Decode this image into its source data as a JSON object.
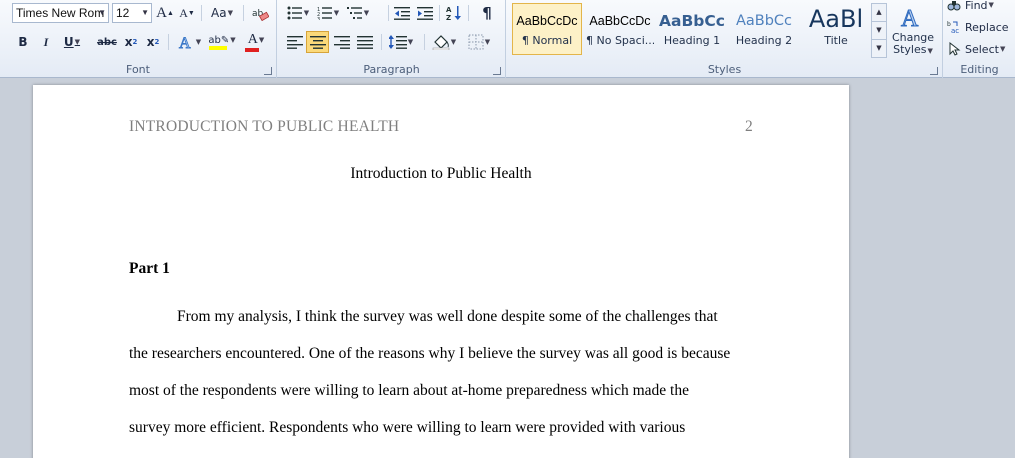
{
  "font_group": {
    "label": "Font",
    "font_name": "Times New Rom",
    "font_size": "12",
    "grow_label": "A",
    "shrink_label": "A",
    "case_label": "Aa",
    "bold": "B",
    "italic": "I",
    "underline": "U",
    "strikethrough": "abc",
    "subscript": "x",
    "subscript_mark": "2",
    "superscript": "x",
    "superscript_mark": "2",
    "highlight_label": "ab",
    "font_color_label": "A"
  },
  "paragraph_group": {
    "label": "Paragraph",
    "pilcrow": "¶"
  },
  "styles_group": {
    "label": "Styles",
    "tiles": [
      {
        "preview": "AaBbCcDc",
        "name": "¶ Normal"
      },
      {
        "preview": "AaBbCcDc",
        "name": "¶ No Spaci..."
      },
      {
        "preview": "AaBbCc",
        "name": "Heading 1"
      },
      {
        "preview": "AaBbCc",
        "name": "Heading 2"
      },
      {
        "preview": "AaBl",
        "name": "Title"
      }
    ],
    "change_styles": "Change Styles",
    "change_line1": "Change",
    "change_line2": "Styles"
  },
  "editing_group": {
    "label": "Editing",
    "find": "Find",
    "replace": "Replace",
    "select": "Select"
  },
  "colors": {
    "accent_heading": "#365f91",
    "heading2": "#4f81bd",
    "font_color_bar": "#e02020",
    "highlight_bar": "#ffff00"
  },
  "document": {
    "header_title": "INTRODUCTION TO PUBLIC HEALTH",
    "header_page": "2",
    "title": "Introduction to Public Health",
    "section_heading": "Part 1",
    "paragraph_lines": [
      "From my analysis,  I think the survey was well  done despite some of the challenges that",
      "the researchers  encountered. One of the reasons  why I believe the survey was all  good is because",
      "most of the respondents were willing to learn about at-home preparedness which made the",
      "survey more  efficient. Respondents who were willing  to learn  were provided with various"
    ]
  }
}
